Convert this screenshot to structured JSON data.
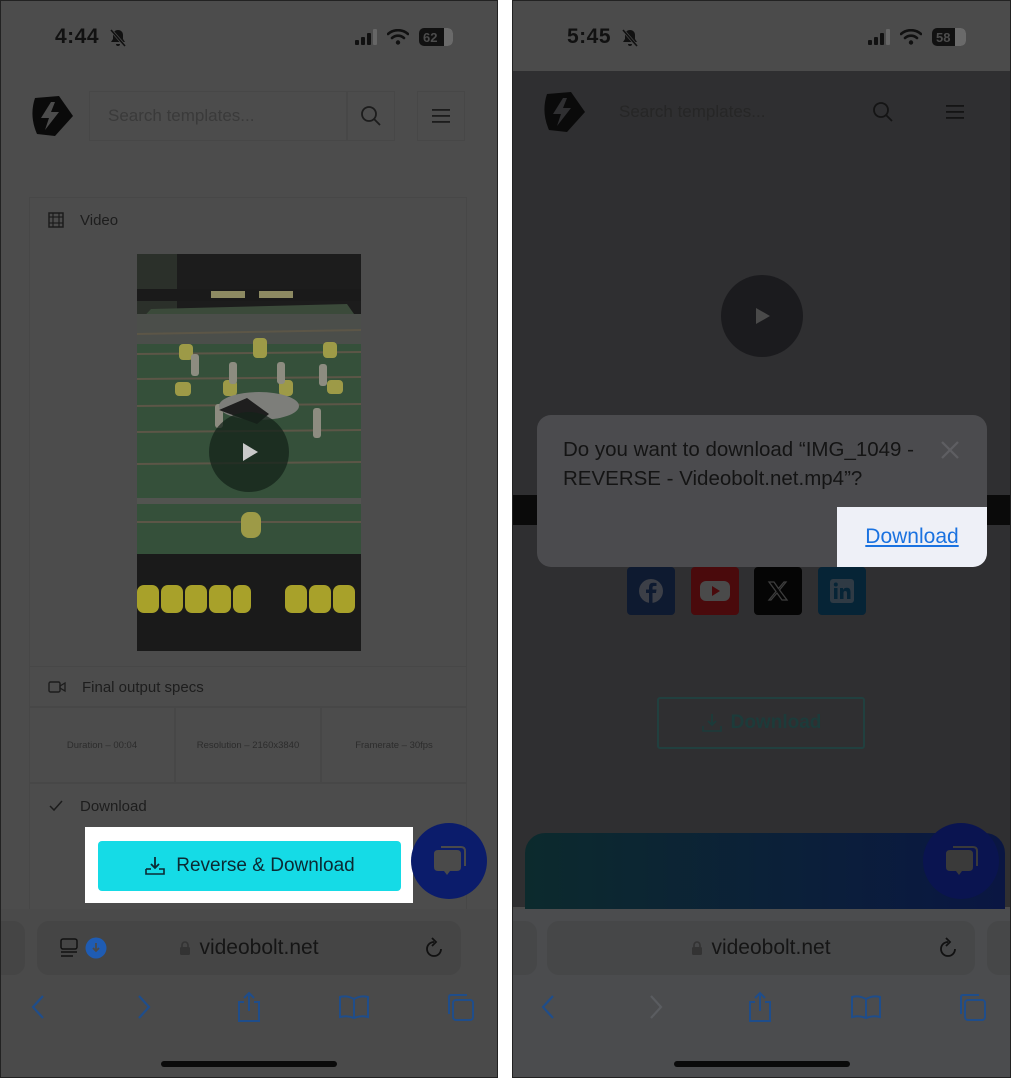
{
  "left_screen": {
    "status_bar": {
      "time": "4:44",
      "silent_icon": "bell-slash-icon",
      "battery": "62"
    },
    "header": {
      "search_placeholder": "Search templates..."
    },
    "video_section": {
      "title": "Video",
      "icon": "film-icon"
    },
    "specs_section": {
      "title": "Final output specs",
      "icon": "video-camera-icon",
      "items": [
        {
          "label": "Duration – 00:04"
        },
        {
          "label": "Resolution – 2160x3840"
        },
        {
          "label": "Framerate – 30fps"
        }
      ]
    },
    "download_section": {
      "title": "Download",
      "icon": "check-icon"
    },
    "primary_button": {
      "label": "Reverse & Download",
      "color": "#15dbe6"
    },
    "browser": {
      "url": "videobolt.net",
      "download_badge": "download-progress-icon"
    }
  },
  "right_screen": {
    "status_bar": {
      "time": "5:45",
      "silent_icon": "bell-slash-icon",
      "battery": "58"
    },
    "header": {
      "search_placeholder": "Search templates..."
    },
    "dialog": {
      "message": "Do you want to download “IMG_1049 - REVERSE - Videobolt.net.mp4”?",
      "confirm_label": "Download",
      "link_color": "#1a72e0"
    },
    "social": [
      "facebook",
      "youtube",
      "x",
      "linkedin"
    ],
    "download_button": {
      "label": "Download"
    },
    "browser": {
      "url": "videobolt.net"
    }
  },
  "colors": {
    "chat_fab": "#0b1c6b",
    "accent": "#15dbe6"
  }
}
